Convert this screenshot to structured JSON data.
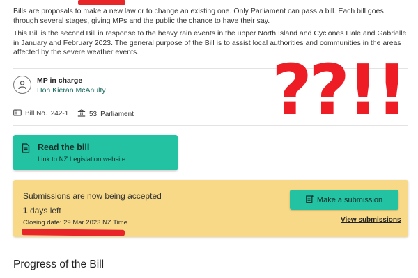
{
  "intro": {
    "p1": "Bills are proposals to make a new law or to change an existing one. Only Parliament can pass a bill. Each bill goes through several stages, giving MPs and the public the chance to have their say.",
    "p2": "This Bill is the second Bill in response to the heavy rain events in the upper North Island and Cyclones Hale and Gabrielle in January and February 2023. The general purpose of the Bill is to assist local authorities and communities in the areas affected by the severe weather events."
  },
  "mp": {
    "icon": "person-icon",
    "title": "MP in charge",
    "name": "Hon Kieran McAnulty"
  },
  "meta": {
    "bill_icon": "ticket-icon",
    "bill_label": "Bill No.",
    "bill_number": "242-1",
    "parliament_icon": "building-columns-icon",
    "parliament_number": "53",
    "parliament_label": "Parliament"
  },
  "annotation": "??!!",
  "read_bill": {
    "icon": "document-icon",
    "title": "Read the bill",
    "subtitle": "Link to NZ Legislation website"
  },
  "submissions": {
    "status": "Submissions are now being accepted",
    "days_count": "1",
    "days_suffix": "days left",
    "closing": "Closing date: 29 Mar 2023 NZ Time",
    "button_icon": "edit-document-icon",
    "button_label": "Make a submission",
    "view_link": "View submissions"
  },
  "progress": {
    "title": "Progress of the Bill"
  },
  "colors": {
    "accent": "#22c2a3",
    "notice": "#f8d987",
    "annotation": "#ee1c24",
    "link": "#1a6a5e"
  }
}
